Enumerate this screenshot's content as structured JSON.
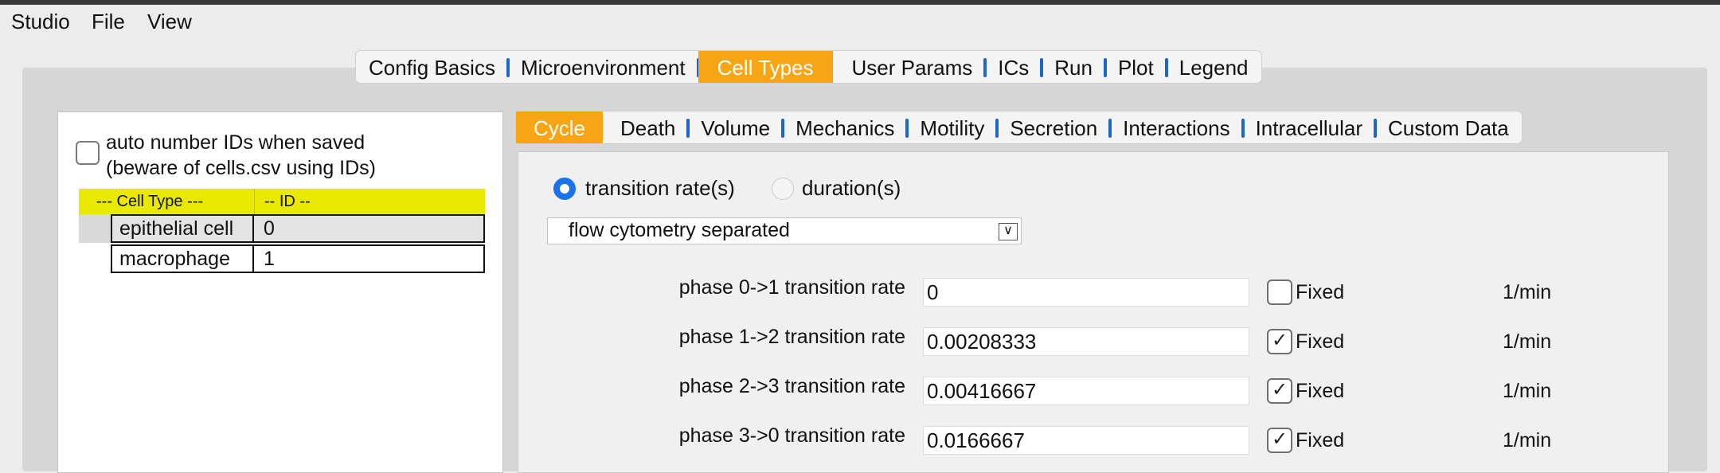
{
  "menu": [
    "Studio",
    "File",
    "View"
  ],
  "top_tabs": [
    {
      "label": "Config Basics",
      "active": false
    },
    {
      "label": "Microenvironment",
      "active": false
    },
    {
      "label": "Cell Types",
      "active": true
    },
    {
      "label": "User Params",
      "active": false
    },
    {
      "label": "ICs",
      "active": false
    },
    {
      "label": "Run",
      "active": false
    },
    {
      "label": "Plot",
      "active": false
    },
    {
      "label": "Legend",
      "active": false
    }
  ],
  "left": {
    "auto_number_line1": "auto number IDs when saved",
    "auto_number_line2": "(beware of cells.csv using IDs)",
    "auto_number_checked": false,
    "table": {
      "headers": [
        "---  Cell Type ---",
        "-- ID --"
      ],
      "rows": [
        {
          "name": "epithelial cell",
          "id": "0",
          "selected": true
        },
        {
          "name": "macrophage",
          "id": "1",
          "selected": false
        }
      ]
    }
  },
  "sub_tabs": [
    {
      "label": "Cycle",
      "active": true
    },
    {
      "label": "Death",
      "active": false
    },
    {
      "label": "Volume",
      "active": false
    },
    {
      "label": "Mechanics",
      "active": false
    },
    {
      "label": "Motility",
      "active": false
    },
    {
      "label": "Secretion",
      "active": false
    },
    {
      "label": "Interactions",
      "active": false
    },
    {
      "label": "Intracellular",
      "active": false
    },
    {
      "label": "Custom Data",
      "active": false
    }
  ],
  "cycle": {
    "radio_rate_label": "transition rate(s)",
    "radio_duration_label": "duration(s)",
    "selected_mode": "rate",
    "model_selected": "flow cytometry separated",
    "params": [
      {
        "label": "phase 0->1 transition rate",
        "value": "0",
        "fixed": false,
        "unit": "1/min"
      },
      {
        "label": "phase 1->2 transition rate",
        "value": "0.00208333",
        "fixed": true,
        "unit": "1/min"
      },
      {
        "label": "phase 2->3 transition rate",
        "value": "0.00416667",
        "fixed": true,
        "unit": "1/min"
      },
      {
        "label": "phase 3->0 transition rate",
        "value": "0.0166667",
        "fixed": true,
        "unit": "1/min"
      }
    ],
    "fixed_label": "Fixed"
  },
  "colors": {
    "active_tab": "#f7a515",
    "tab_separator": "#1d66c8",
    "table_header": "#e9e800",
    "radio_on": "#1a73e8"
  }
}
